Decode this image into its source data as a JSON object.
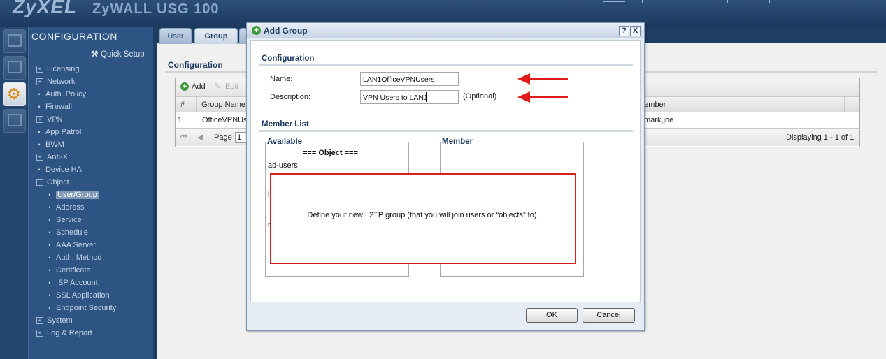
{
  "header": {
    "logo": "ZyXEL",
    "product": "ZyWALL USG 100"
  },
  "sidebar": {
    "title": "CONFIGURATION",
    "quick_setup": "Quick Setup",
    "items": [
      {
        "label": "Licensing",
        "kind": "expand"
      },
      {
        "label": "Network",
        "kind": "expand"
      },
      {
        "label": "Auth. Policy",
        "kind": "leaf"
      },
      {
        "label": "Firewall",
        "kind": "leaf"
      },
      {
        "label": "VPN",
        "kind": "expand"
      },
      {
        "label": "App Patrol",
        "kind": "leaf"
      },
      {
        "label": "BWM",
        "kind": "leaf"
      },
      {
        "label": "Anti-X",
        "kind": "expand"
      },
      {
        "label": "Device HA",
        "kind": "leaf"
      },
      {
        "label": "Object",
        "kind": "collapse"
      },
      {
        "label": "User/Group",
        "kind": "sub",
        "selected": true
      },
      {
        "label": "Address",
        "kind": "sub"
      },
      {
        "label": "Service",
        "kind": "sub"
      },
      {
        "label": "Schedule",
        "kind": "sub"
      },
      {
        "label": "AAA Server",
        "kind": "sub"
      },
      {
        "label": "Auth. Method",
        "kind": "sub"
      },
      {
        "label": "Certificate",
        "kind": "sub"
      },
      {
        "label": "ISP Account",
        "kind": "sub"
      },
      {
        "label": "SSL Application",
        "kind": "sub"
      },
      {
        "label": "Endpoint Security",
        "kind": "sub"
      },
      {
        "label": "System",
        "kind": "expand"
      },
      {
        "label": "Log & Report",
        "kind": "expand"
      }
    ]
  },
  "tabs": [
    {
      "label": "User",
      "active": false
    },
    {
      "label": "Group",
      "active": true
    }
  ],
  "main": {
    "title": "Configuration",
    "toolbar": {
      "add": "Add",
      "edit": "Edit"
    },
    "columns": [
      "#",
      "Group Name",
      "Member"
    ],
    "rows": [
      {
        "index": "1",
        "group": "OfficeVPNUs",
        "member": ",mark,joe"
      }
    ],
    "pager": {
      "page_label": "Page",
      "page": "1",
      "display": "Displaying 1 - 1 of 1"
    }
  },
  "dialog": {
    "title": "Add Group",
    "help": "?",
    "close": "X",
    "config_section": "Configuration",
    "name_label": "Name:",
    "name_value": "LAN1OfficeVPNUsers",
    "desc_label": "Description:",
    "desc_value": "VPN Users to LAN1",
    "optional": "(Optional)",
    "member_section": "Member List",
    "available_label": "Available",
    "object_heading": "=== Object ===",
    "available_items": [
      "ad-users",
      "l",
      "r"
    ],
    "member_label": "Member",
    "ok": "OK",
    "cancel": "Cancel"
  },
  "annotation": {
    "callout": "Define your new L2TP group (that you will join users or “objects” to).",
    "color": "#e11b1b"
  }
}
